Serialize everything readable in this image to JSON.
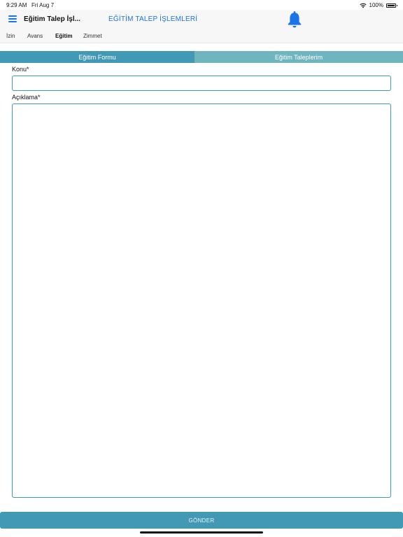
{
  "status_bar": {
    "time": "9:29 AM",
    "date": "Fri Aug 7",
    "battery": "100%"
  },
  "nav": {
    "title": "Eğitim Talep İşl...",
    "heading": "EĞİTİM TALEP İŞLEMLERİ"
  },
  "top_tabs": [
    {
      "label": "İzin"
    },
    {
      "label": "Avans"
    },
    {
      "label": "Eğitim"
    },
    {
      "label": "Zimmet"
    }
  ],
  "segments": [
    {
      "label": "Eğitim Formu"
    },
    {
      "label": "Eğitim Taleplerim"
    }
  ],
  "form": {
    "subject_label": "Konu*",
    "subject_value": "",
    "description_label": "Açıklama*",
    "description_value": ""
  },
  "submit_label": "GÖNDER",
  "colors": {
    "accent": "#1a73e8",
    "segment_active": "#4199b6",
    "segment_inactive": "#6fb5bf",
    "button": "#4199b6"
  }
}
